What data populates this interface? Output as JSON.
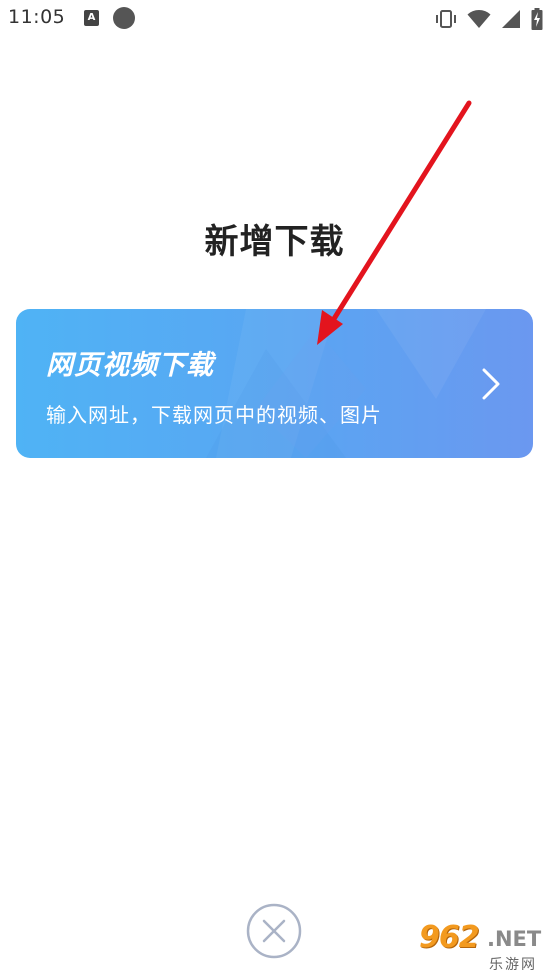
{
  "status_bar": {
    "time": "11:05",
    "a_icon_label": "A",
    "icons": [
      "a-notification-icon",
      "circle-notification-icon",
      "vibrate-icon",
      "wifi-icon",
      "signal-icon",
      "battery-charging-icon"
    ]
  },
  "page": {
    "title": "新增下载"
  },
  "card": {
    "title": "网页视频下载",
    "subtitle": "输入网址，下载网页中的视频、图片",
    "chevron_icon": "chevron-right-icon"
  },
  "close": {
    "icon": "close-circle-icon"
  },
  "watermark": {
    "number": "962",
    "net": ".NET",
    "name": "乐游网"
  },
  "colors": {
    "card_start": "#4fb3f5",
    "card_end": "#6b98f0",
    "arrow": "#e3141e",
    "title": "#222222",
    "close_icon": "#aab3c6"
  }
}
